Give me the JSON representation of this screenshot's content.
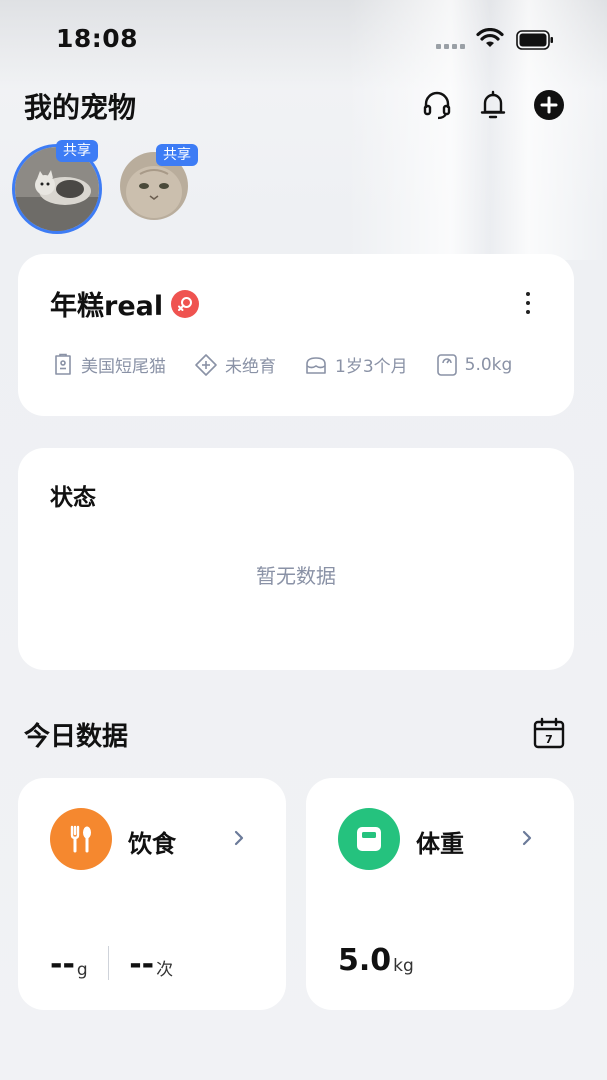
{
  "status_bar": {
    "time": "18:08"
  },
  "header": {
    "title": "我的宠物"
  },
  "pets": [
    {
      "name": "cat-avatar-1",
      "share_label": "共享"
    },
    {
      "name": "cat-avatar-2",
      "share_label": "共享"
    }
  ],
  "pet_card": {
    "name": "年糕real",
    "breed": "美国短尾猫",
    "neutered": "未绝育",
    "age": "1岁3个月",
    "weight": "5.0kg"
  },
  "status_card": {
    "title": "状态",
    "empty": "暂无数据"
  },
  "today": {
    "title": "今日数据",
    "calendar_day": "7",
    "food": {
      "title": "饮食",
      "amount": "--",
      "amount_unit": "g",
      "count": "--",
      "count_unit": "次"
    },
    "weight": {
      "title": "体重",
      "value": "5.0",
      "unit": "kg"
    }
  },
  "colors": {
    "accent_blue": "#3d7cf5",
    "food_orange": "#f5882f",
    "weight_green": "#25c27e",
    "gender_red": "#ef5350",
    "muted_text": "#8a92a6"
  }
}
